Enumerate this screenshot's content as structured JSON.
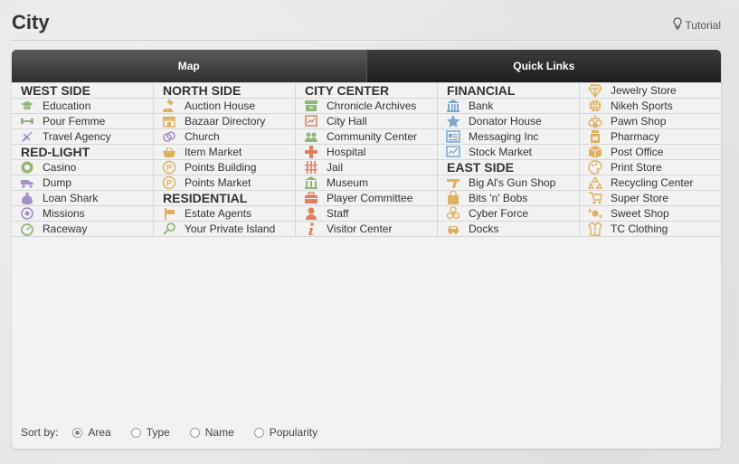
{
  "header": {
    "title": "City",
    "tutorial_label": "Tutorial"
  },
  "tabs": [
    {
      "label": "Map"
    },
    {
      "label": "Quick Links"
    }
  ],
  "columns": [
    [
      {
        "type": "head",
        "label": "WEST SIDE"
      },
      {
        "type": "link",
        "label": "Education",
        "icon": "graduation-cap-icon",
        "color": "#8fb878"
      },
      {
        "type": "link",
        "label": "Pour Femme",
        "icon": "dumbbell-icon",
        "color": "#8fb878"
      },
      {
        "type": "link",
        "label": "Travel Agency",
        "icon": "airplane-icon",
        "color": "#a58fc7"
      },
      {
        "type": "head",
        "label": "RED-LIGHT"
      },
      {
        "type": "link",
        "label": "Casino",
        "icon": "chip-icon",
        "color": "#8fb878"
      },
      {
        "type": "link",
        "label": "Dump",
        "icon": "truck-icon",
        "color": "#a58fc7"
      },
      {
        "type": "link",
        "label": "Loan Shark",
        "icon": "money-bag-icon",
        "color": "#a58fc7"
      },
      {
        "type": "link",
        "label": "Missions",
        "icon": "target-icon",
        "color": "#a58fc7"
      },
      {
        "type": "link",
        "label": "Raceway",
        "icon": "speedometer-icon",
        "color": "#8fb878"
      }
    ],
    [
      {
        "type": "head",
        "label": "NORTH SIDE"
      },
      {
        "type": "link",
        "label": "Auction House",
        "icon": "gavel-icon",
        "color": "#e0b060"
      },
      {
        "type": "link",
        "label": "Bazaar Directory",
        "icon": "storefront-icon",
        "color": "#e0b060"
      },
      {
        "type": "link",
        "label": "Church",
        "icon": "rings-icon",
        "color": "#a58fc7"
      },
      {
        "type": "link",
        "label": "Item Market",
        "icon": "basket-icon",
        "color": "#e0b060"
      },
      {
        "type": "link",
        "label": "Points Building",
        "icon": "points-p-icon",
        "color": "#e0b060"
      },
      {
        "type": "link",
        "label": "Points Market",
        "icon": "points-p-icon",
        "color": "#e0b060"
      },
      {
        "type": "head",
        "label": "RESIDENTIAL"
      },
      {
        "type": "link",
        "label": "Estate Agents",
        "icon": "signpost-icon",
        "color": "#e0b060"
      },
      {
        "type": "link",
        "label": "Your Private Island",
        "icon": "magnifier-icon",
        "color": "#8fb878"
      }
    ],
    [
      {
        "type": "head",
        "label": "CITY CENTER"
      },
      {
        "type": "link",
        "label": "Chronicle Archives",
        "icon": "archive-icon",
        "color": "#8fb878"
      },
      {
        "type": "link",
        "label": "City Hall",
        "icon": "chart-board-icon",
        "color": "#e08060"
      },
      {
        "type": "link",
        "label": "Community Center",
        "icon": "people-icon",
        "color": "#8fb878"
      },
      {
        "type": "link",
        "label": "Hospital",
        "icon": "medical-cross-icon",
        "color": "#e08060"
      },
      {
        "type": "link",
        "label": "Jail",
        "icon": "bars-icon",
        "color": "#e08060"
      },
      {
        "type": "link",
        "label": "Museum",
        "icon": "museum-icon",
        "color": "#8fb878"
      },
      {
        "type": "link",
        "label": "Player Committee",
        "icon": "briefcase-icon",
        "color": "#e08060"
      },
      {
        "type": "link",
        "label": "Staff",
        "icon": "person-icon",
        "color": "#e08060"
      },
      {
        "type": "link",
        "label": "Visitor Center",
        "icon": "info-icon",
        "color": "#e08060"
      }
    ],
    [
      {
        "type": "head",
        "label": "FINANCIAL"
      },
      {
        "type": "link",
        "label": "Bank",
        "icon": "bank-icon",
        "color": "#7ba7cf"
      },
      {
        "type": "link",
        "label": "Donator House",
        "icon": "star-icon",
        "color": "#7ba7cf"
      },
      {
        "type": "link",
        "label": "Messaging Inc",
        "icon": "message-icon",
        "color": "#7ba7cf"
      },
      {
        "type": "link",
        "label": "Stock Market",
        "icon": "stock-chart-icon",
        "color": "#7ba7cf"
      },
      {
        "type": "head",
        "label": "EAST SIDE"
      },
      {
        "type": "link",
        "label": "Big Al's Gun Shop",
        "icon": "gun-icon",
        "color": "#e0b060"
      },
      {
        "type": "link",
        "label": "Bits 'n' Bobs",
        "icon": "shopping-bag-icon",
        "color": "#e0b060"
      },
      {
        "type": "link",
        "label": "Cyber Force",
        "icon": "biohazard-icon",
        "color": "#e0b060"
      },
      {
        "type": "link",
        "label": "Docks",
        "icon": "car-icon",
        "color": "#e0b060"
      }
    ],
    [
      {
        "type": "link",
        "label": "Jewelry Store",
        "icon": "diamond-icon",
        "color": "#e0b060"
      },
      {
        "type": "link",
        "label": "Nikeh Sports",
        "icon": "basketball-icon",
        "color": "#e0b060"
      },
      {
        "type": "link",
        "label": "Pawn Shop",
        "icon": "pawn-balls-icon",
        "color": "#e0b060"
      },
      {
        "type": "link",
        "label": "Pharmacy",
        "icon": "pill-bottle-icon",
        "color": "#e0b060"
      },
      {
        "type": "link",
        "label": "Post Office",
        "icon": "package-icon",
        "color": "#e0b060"
      },
      {
        "type": "link",
        "label": "Print Store",
        "icon": "palette-icon",
        "color": "#e0b060"
      },
      {
        "type": "link",
        "label": "Recycling Center",
        "icon": "recycle-icon",
        "color": "#e0b060"
      },
      {
        "type": "link",
        "label": "Super Store",
        "icon": "cart-icon",
        "color": "#e0b060"
      },
      {
        "type": "link",
        "label": "Sweet Shop",
        "icon": "candy-icon",
        "color": "#e0b060"
      },
      {
        "type": "link",
        "label": "TC Clothing",
        "icon": "jacket-icon",
        "color": "#e0b060"
      }
    ]
  ],
  "sort": {
    "label": "Sort by:",
    "options": [
      {
        "label": "Area",
        "selected": true
      },
      {
        "label": "Type",
        "selected": false
      },
      {
        "label": "Name",
        "selected": false
      },
      {
        "label": "Popularity",
        "selected": false
      }
    ]
  }
}
